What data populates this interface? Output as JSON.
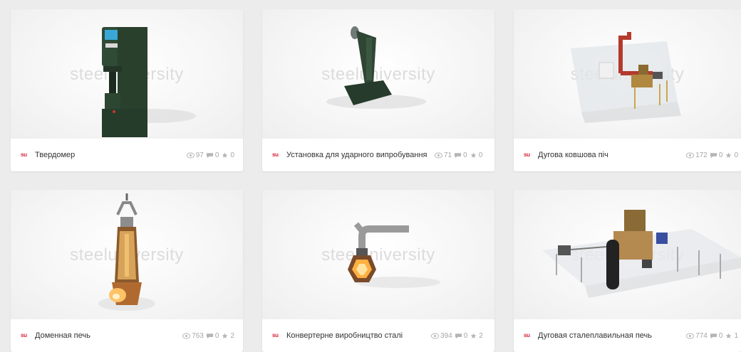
{
  "watermark_text": "steeluniversity",
  "brand_badge": "su",
  "colors": {
    "badge": "#d9243a",
    "stat_text": "#a6a6a6",
    "card_bg": "#ffffff",
    "page_bg": "#ececec"
  },
  "cards": [
    {
      "title": "Твердомер",
      "views": "97",
      "comments": "0",
      "likes": "0"
    },
    {
      "title": "Установка для ударного випробування",
      "views": "71",
      "comments": "0",
      "likes": "0"
    },
    {
      "title": "Дугова ковшова піч",
      "views": "172",
      "comments": "0",
      "likes": "0"
    },
    {
      "title": "Доменная печь",
      "views": "763",
      "comments": "0",
      "likes": "2"
    },
    {
      "title": "Конвертерне виробництво сталі",
      "views": "394",
      "comments": "0",
      "likes": "2"
    },
    {
      "title": "Дуговая сталеплавильная печь",
      "views": "774",
      "comments": "0",
      "likes": "1"
    }
  ],
  "icons": {
    "views": "eye-icon",
    "comments": "comment-icon",
    "likes": "star-icon",
    "badge": "su-logo-icon"
  }
}
